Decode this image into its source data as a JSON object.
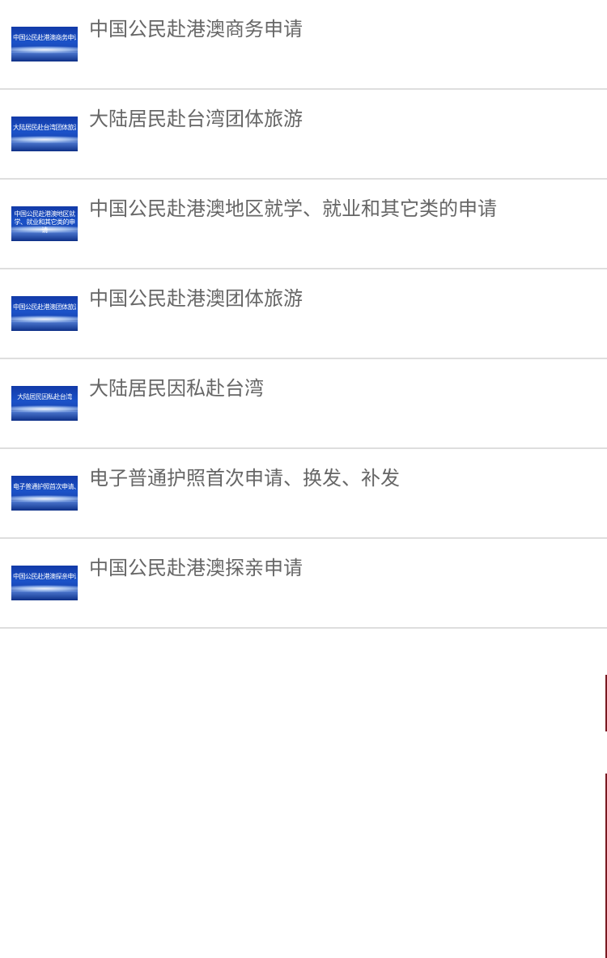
{
  "items": [
    {
      "title": "中国公民赴港澳商务申请",
      "thumb_caption": "中国公民赴港澳商务申请",
      "icon": "service-banner-thumbnail"
    },
    {
      "title": "大陆居民赴台湾团体旅游",
      "thumb_caption": "大陆居民赴台湾团体旅游",
      "icon": "service-banner-thumbnail"
    },
    {
      "title": "中国公民赴港澳地区就学、就业和其它类的申请",
      "thumb_caption": "中国公民赴港澳地区就学、就业和其它类的申请",
      "icon": "service-banner-thumbnail"
    },
    {
      "title": "中国公民赴港澳团体旅游",
      "thumb_caption": "中国公民赴港澳团体旅游",
      "icon": "service-banner-thumbnail"
    },
    {
      "title": "大陆居民因私赴台湾",
      "thumb_caption": "大陆居民因私赴台湾",
      "icon": "service-banner-thumbnail"
    },
    {
      "title": "电子普通护照首次申请、换发、补发",
      "thumb_caption": "电子普通护照首次申请、换发、补发",
      "icon": "service-banner-thumbnail"
    },
    {
      "title": "中国公民赴港澳探亲申请",
      "thumb_caption": "中国公民赴港澳探亲申请",
      "icon": "service-banner-thumbnail"
    }
  ],
  "colors": {
    "title_text": "#666666",
    "divider": "#dedede",
    "thumb_blue": "#1b52c8",
    "edge_mark": "#7a1a22"
  }
}
